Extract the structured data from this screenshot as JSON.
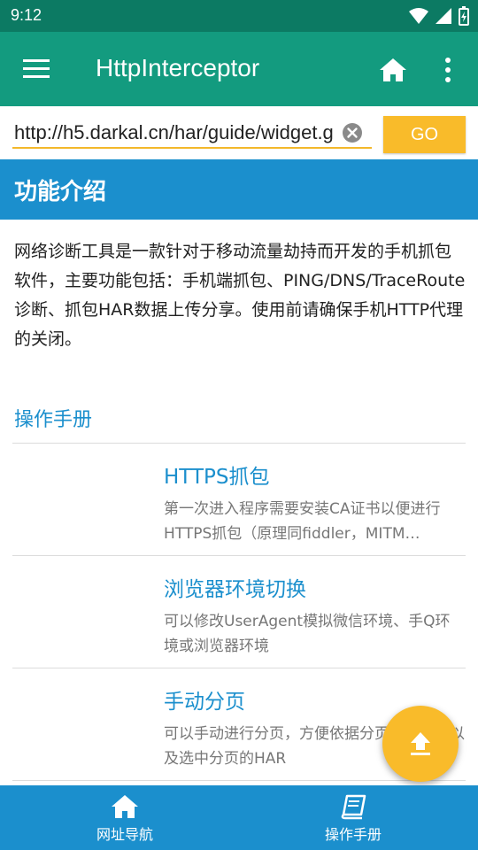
{
  "status_bar": {
    "time": "9:12"
  },
  "app_bar": {
    "title": "HttpInterceptor"
  },
  "url_bar": {
    "value": "http://h5.darkal.cn/har/guide/widget.g",
    "go_label": "GO"
  },
  "section": {
    "title": "功能介绍"
  },
  "intro": {
    "text": "网络诊断工具是一款针对于移动流量劫持而开发的手机抓包软件，主要功能包括：手机端抓包、PING/DNS/TraceRoute诊断、抓包HAR数据上传分享。使用前请确保手机HTTP代理的关闭。"
  },
  "manual": {
    "title": "操作手册",
    "items": [
      {
        "title": "HTTPS抓包",
        "desc": "第一次进入程序需要安装CA证书以便进行HTTPS抓包（原理同fiddler，MITM…"
      },
      {
        "title": "浏览器环境切换",
        "desc": "可以修改UserAgent模拟微信环境、手Q环境或浏览器环境"
      },
      {
        "title": "手动分页",
        "desc": "可以手动进行分页，方便依据分页预览数据以及选中分页的HAR"
      }
    ]
  },
  "bottom_nav": {
    "items": [
      {
        "label": "网址导航",
        "icon": "home-icon"
      },
      {
        "label": "操作手册",
        "icon": "book-icon"
      }
    ]
  },
  "colors": {
    "status_bar": "#0c7a63",
    "app_bar": "#139b7f",
    "accent_blue": "#1b8fcd",
    "accent_yellow": "#f9bb2a"
  }
}
